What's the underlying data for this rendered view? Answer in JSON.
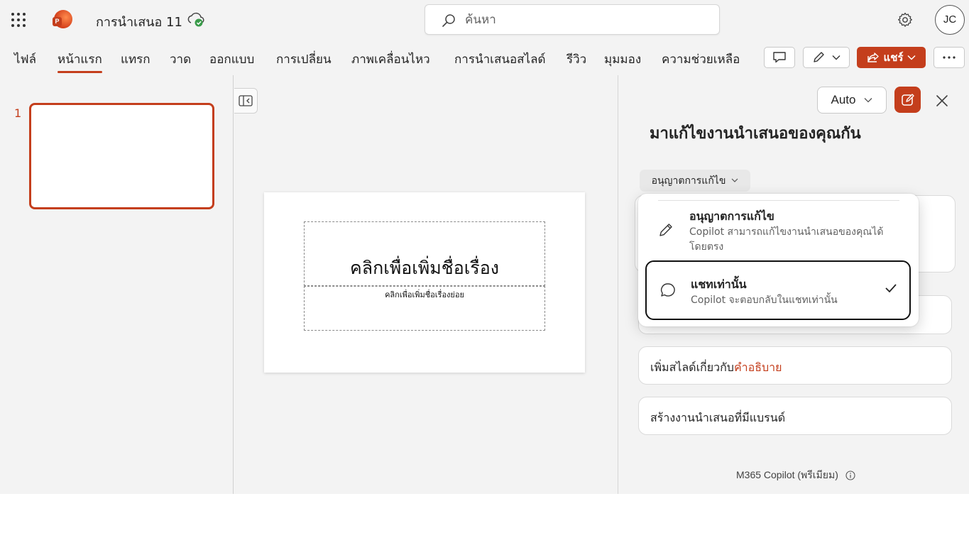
{
  "app": {
    "doc_title": "การนำเสนอ 11",
    "search_placeholder": "ค้นหา",
    "avatar_initials": "JC"
  },
  "ribbon": {
    "tabs": [
      "ไฟล์",
      "หน้าแรก",
      "แทรก",
      "วาด",
      "ออกแบบ",
      "การเปลี่ยน",
      "ภาพเคลื่อนไหว",
      "การนำเสนอสไลด์",
      "รีวิว",
      "มุมมอง",
      "ความช่วยเหลือ"
    ],
    "active_tab": "หน้าแรก",
    "share_label": "แชร์"
  },
  "thumbnails": {
    "slide_number": "1"
  },
  "slide": {
    "title_placeholder": "คลิกเพื่อเพิ่มชื่อเรื่อง",
    "subtitle_placeholder": "คลิกเพื่อเพิ่มชื่อเรื่องย่อย"
  },
  "copilot": {
    "mode_label": "Auto",
    "heading": "มาแก้ไขงานนำเสนอของคุณกัน",
    "permission_label": "อนุญาตการแก้ไข",
    "suggestions": [
      {
        "text": "เพิ่มสไลด์เกี่ยวกับ",
        "accent": "คำอธิบาย"
      },
      {
        "text": "สร้างงานนำเสนอที่มีแบรนด์",
        "accent": ""
      }
    ],
    "footer": "M365 Copilot (พรีเมียม)"
  },
  "permission_menu": {
    "items": [
      {
        "title": "อนุญาตการแก้ไข",
        "description": "Copilot สามารถแก้ไขงานนำเสนอของคุณได้โดยตรง",
        "icon": "pencil-icon",
        "selected": false
      },
      {
        "title": "แชทเท่านั้น",
        "description": "Copilot จะตอบกลับในแชทเท่านั้น",
        "icon": "chat-bubble-icon",
        "selected": true
      }
    ]
  },
  "colors": {
    "accent": "#c43e1c",
    "pane_bg": "#f3f3f3"
  }
}
